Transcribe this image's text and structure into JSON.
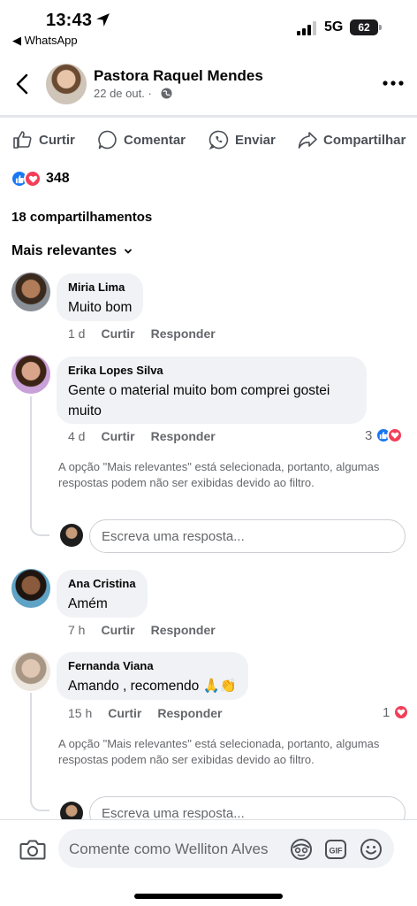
{
  "status": {
    "time": "13:43",
    "back_app": "◀ WhatsApp",
    "network": "5G",
    "battery": "62"
  },
  "post": {
    "author": "Pastora Raquel Mendes",
    "date": "22 de out. ·"
  },
  "actions": {
    "like": "Curtir",
    "comment": "Comentar",
    "send": "Enviar",
    "share": "Compartilhar"
  },
  "reactions": {
    "count": "348"
  },
  "shares": "18 compartilhamentos",
  "sort": {
    "label": "Mais relevantes"
  },
  "comments": [
    {
      "name": "Miria Lima",
      "text": "Muito bom",
      "time": "1 d",
      "like": "Curtir",
      "reply": "Responder"
    },
    {
      "name": "Erika Lopes Silva",
      "text": "Gente o material muito bom comprei gostei muito",
      "time": "4 d",
      "like": "Curtir",
      "reply": "Responder",
      "reaction_count": "3",
      "notice": "A opção \"Mais relevantes\" está selecionada, portanto, algumas respostas podem não ser exibidas devido ao filtro.",
      "reply_placeholder": "Escreva uma resposta..."
    },
    {
      "name": "Ana Cristina",
      "text": "Amém",
      "time": "7 h",
      "like": "Curtir",
      "reply": "Responder"
    },
    {
      "name": "Fernanda Viana",
      "text": "Amando , recomendo 🙏👏",
      "time": "15 h",
      "like": "Curtir",
      "reply": "Responder",
      "reaction_count": "1",
      "notice": "A opção \"Mais relevantes\" está selecionada, portanto, algumas respostas podem não ser exibidas devido ao filtro.",
      "reply_placeholder": "Escreva uma resposta..."
    }
  ],
  "composer": {
    "placeholder": "Comente como Welliton Alves"
  },
  "icons": [
    "location-arrow-icon",
    "signal-icon",
    "back-icon",
    "globe-icon",
    "more-icon",
    "like-icon",
    "comment-icon",
    "whatsapp-icon",
    "share-icon",
    "camera-icon",
    "avatar-sticker-icon",
    "gif-icon",
    "emoji-icon"
  ],
  "colors": {
    "accent": "#1877f2",
    "love": "#f33e58",
    "bubble": "#f0f2f5",
    "secondary_text": "#65676b"
  }
}
